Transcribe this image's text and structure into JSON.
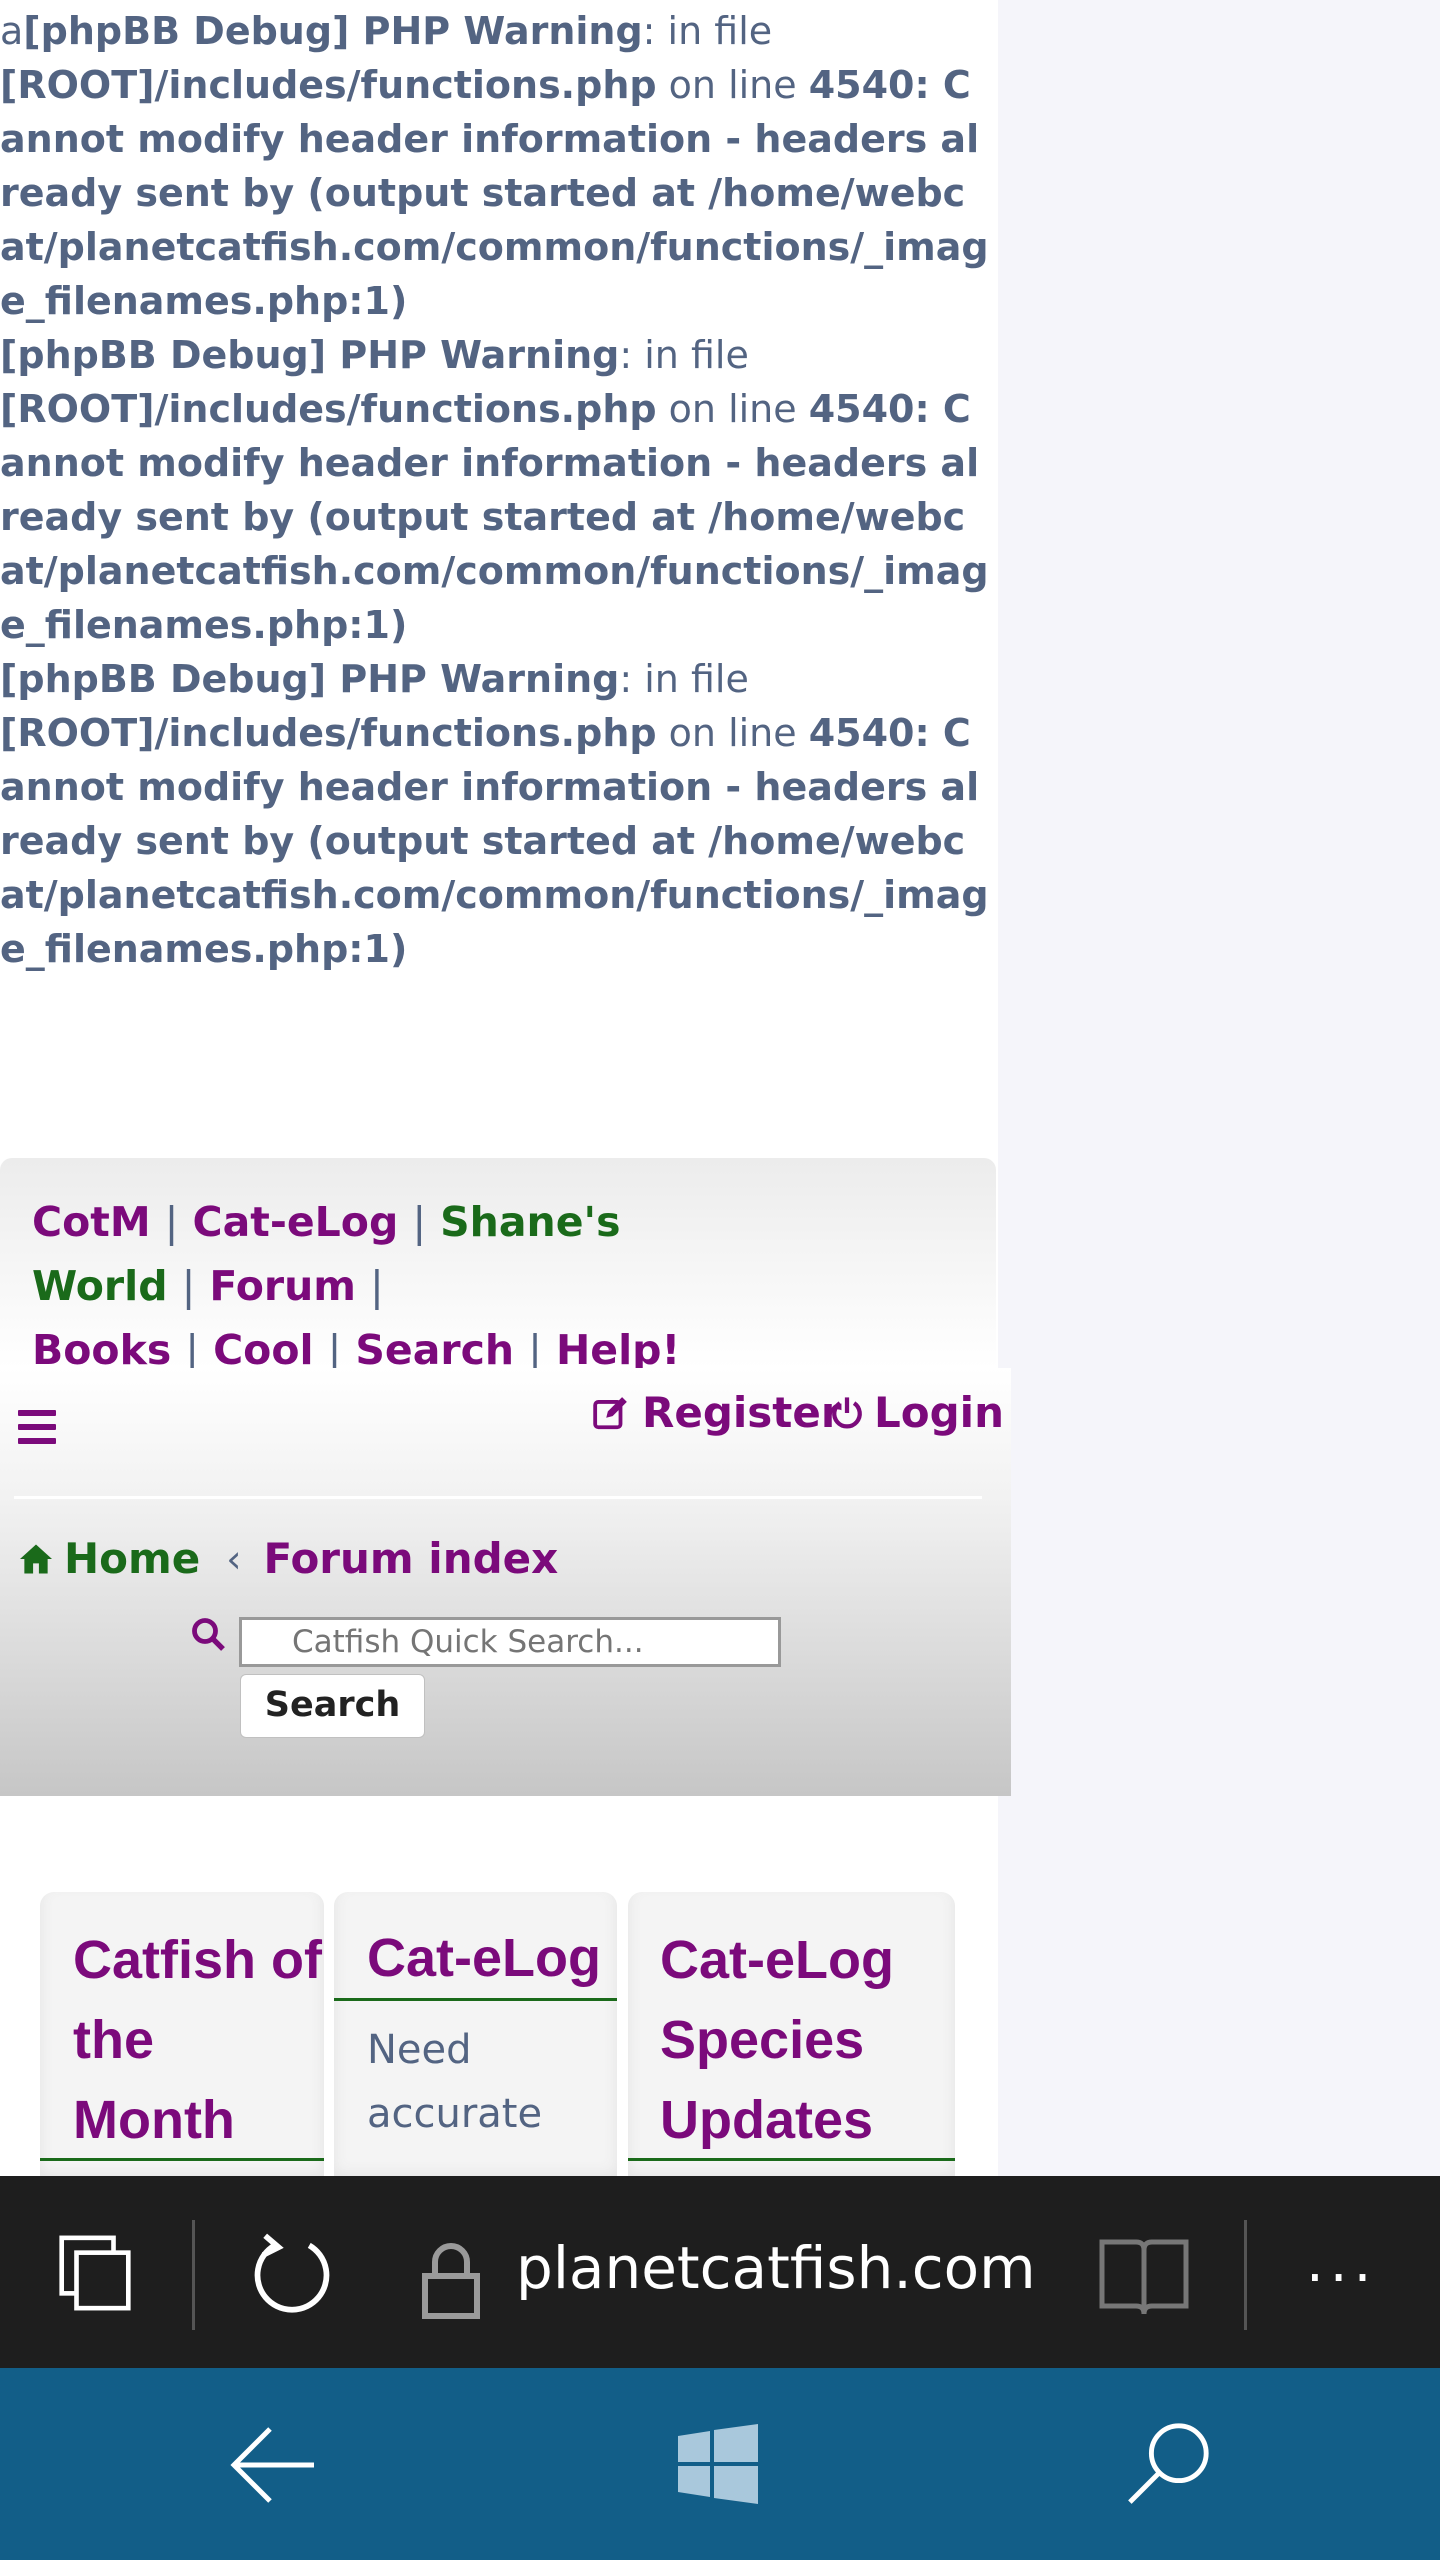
{
  "debug": {
    "prefix": "a",
    "warnings": [
      {
        "tag": "[phpBB Debug] PHP Warning",
        "in_file": ": in file",
        "path": "[ROOT]/includes/functions.php",
        "on_line": " on line ",
        "line": "4540",
        "message": ": Cannot modify header information - headers already sent by (output started at /home/webcat/planetcatfish.com/common/functions/_image_filenames.php:1)"
      },
      {
        "tag": "[phpBB Debug] PHP Warning",
        "in_file": ": in file",
        "path": "[ROOT]/includes/functions.php",
        "on_line": " on line ",
        "line": "4540",
        "message": ": Cannot modify header information - headers already sent by (output started at /home/webcat/planetcatfish.com/common/functions/_image_filenames.php:1)"
      },
      {
        "tag": "[phpBB Debug] PHP Warning",
        "in_file": ": in file",
        "path": "[ROOT]/includes/functions.php",
        "on_line": " on line ",
        "line": "4540",
        "message": ": Cannot modify header information - headers already sent by (output started at /home/webcat/planetcatfish.com/common/functions/_image_filenames.php:1)"
      }
    ]
  },
  "topnav": {
    "links": [
      "CotM",
      "Cat-eLog",
      "Shane's World",
      "Forum",
      "Books",
      "Cool",
      "Search",
      "Help!"
    ],
    "separator": "|"
  },
  "header": {
    "register": "Register",
    "login": "Login",
    "breadcrumb": {
      "home": "Home",
      "chevron": "‹",
      "forum_index": "Forum index"
    },
    "search": {
      "placeholder": "Catfish Quick Search...",
      "button": "Search"
    }
  },
  "cards": [
    {
      "title": "Catfish of the Month",
      "body": ""
    },
    {
      "title": "Cat-eLog",
      "body": "Need accurate"
    },
    {
      "title": "Cat-eLog Species Updates",
      "body": ""
    }
  ],
  "browser": {
    "url": "planetcatfish.com",
    "more": "···"
  },
  "colors": {
    "link_purple": "#7b0a7b",
    "link_green": "#1a6a1a",
    "text": "#536482",
    "browser_bar": "#1e1e1e",
    "system_nav": "#125e88"
  }
}
